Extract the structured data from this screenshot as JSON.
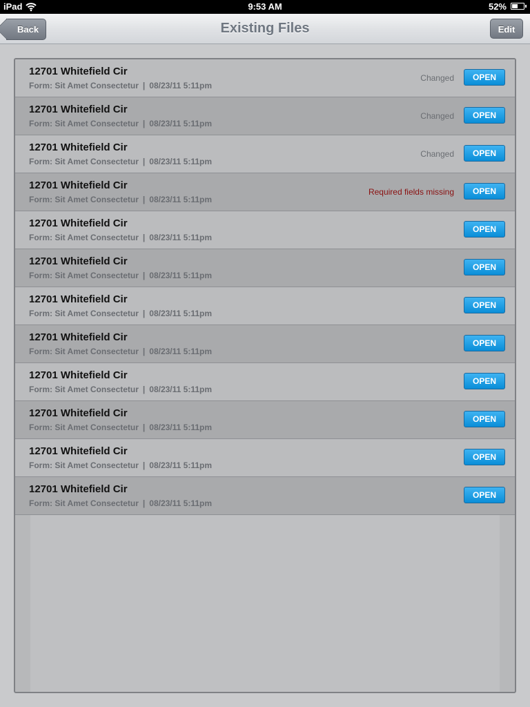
{
  "status_bar": {
    "device": "iPad",
    "time": "9:53 AM",
    "battery": "52%",
    "battery_level": 0.52
  },
  "nav": {
    "title": "Existing Files",
    "back_label": "Back",
    "edit_label": "Edit"
  },
  "files": [
    {
      "title": "12701 Whitefield Cir",
      "form": "Form: Sit Amet Consectetur",
      "date": "08/23/11 5:11pm",
      "status": "Changed",
      "status_type": "changed",
      "open_label": "OPEN"
    },
    {
      "title": "12701 Whitefield Cir",
      "form": "Form: Sit Amet Consectetur",
      "date": "08/23/11 5:11pm",
      "status": "Changed",
      "status_type": "changed",
      "open_label": "OPEN"
    },
    {
      "title": "12701 Whitefield Cir",
      "form": "Form: Sit Amet Consectetur",
      "date": "08/23/11 5:11pm",
      "status": "Changed",
      "status_type": "changed",
      "open_label": "OPEN"
    },
    {
      "title": "12701 Whitefield Cir",
      "form": "Form: Sit Amet Consectetur",
      "date": "08/23/11 5:11pm",
      "status": "Required fields missing",
      "status_type": "error",
      "open_label": "OPEN"
    },
    {
      "title": "12701 Whitefield Cir",
      "form": "Form: Sit Amet Consectetur",
      "date": "08/23/11 5:11pm",
      "status": "",
      "status_type": "",
      "open_label": "OPEN"
    },
    {
      "title": "12701 Whitefield Cir",
      "form": "Form: Sit Amet Consectetur",
      "date": "08/23/11 5:11pm",
      "status": "",
      "status_type": "",
      "open_label": "OPEN"
    },
    {
      "title": "12701 Whitefield Cir",
      "form": "Form: Sit Amet Consectetur",
      "date": "08/23/11 5:11pm",
      "status": "",
      "status_type": "",
      "open_label": "OPEN"
    },
    {
      "title": "12701 Whitefield Cir",
      "form": "Form: Sit Amet Consectetur",
      "date": "08/23/11 5:11pm",
      "status": "",
      "status_type": "",
      "open_label": "OPEN"
    },
    {
      "title": "12701 Whitefield Cir",
      "form": "Form: Sit Amet Consectetur",
      "date": "08/23/11 5:11pm",
      "status": "",
      "status_type": "",
      "open_label": "OPEN"
    },
    {
      "title": "12701 Whitefield Cir",
      "form": "Form: Sit Amet Consectetur",
      "date": "08/23/11 5:11pm",
      "status": "",
      "status_type": "",
      "open_label": "OPEN"
    },
    {
      "title": "12701 Whitefield Cir",
      "form": "Form: Sit Amet Consectetur",
      "date": "08/23/11 5:11pm",
      "status": "",
      "status_type": "",
      "open_label": "OPEN"
    },
    {
      "title": "12701 Whitefield Cir",
      "form": "Form: Sit Amet Consectetur",
      "date": "08/23/11 5:11pm",
      "status": "",
      "status_type": "",
      "open_label": "OPEN"
    }
  ],
  "colors": {
    "open_button": "#1a9be6",
    "error_status": "#8a1010",
    "nav_title": "#6f7781"
  }
}
